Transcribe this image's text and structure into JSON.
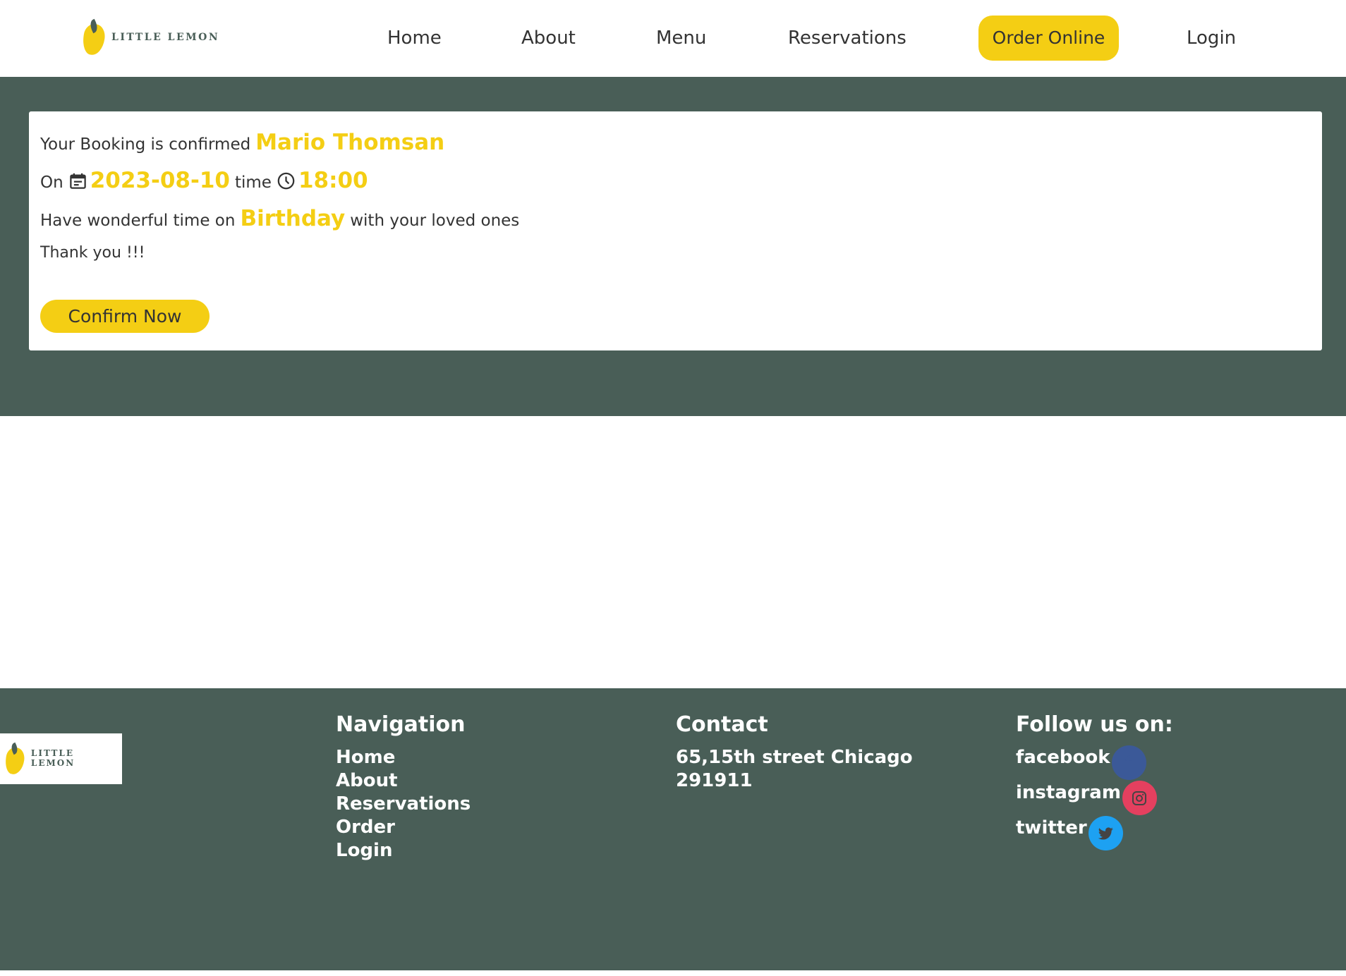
{
  "brand": {
    "name": "LITTLE LEMON"
  },
  "nav": {
    "home": "Home",
    "about": "About",
    "menu": "Menu",
    "reservations": "Reservations",
    "order_online": "Order Online",
    "login": "Login"
  },
  "booking": {
    "confirmed_text": "Your Booking is confirmed",
    "name": "Mario Thomsan",
    "on_text": "On",
    "date": "2023-08-10",
    "time_text": "time",
    "time": "18:00",
    "wish_prefix": "Have wonderful time on",
    "occasion": "Birthday",
    "wish_suffix": "with your loved ones",
    "thanks": "Thank you !!!",
    "confirm_button": "Confirm Now",
    "icons": [
      "calendar-icon",
      "clock-icon"
    ]
  },
  "footer": {
    "navigation": {
      "heading": "Navigation",
      "links": [
        "Home",
        "About",
        "Reservations",
        "Order",
        "Login"
      ]
    },
    "contact": {
      "heading": "Contact",
      "address": "65,15th street Chicago",
      "zip": "291911"
    },
    "follow": {
      "heading": "Follow us on:",
      "items": [
        {
          "label": "facebook",
          "icon": "facebook-icon",
          "color": "#3b5998"
        },
        {
          "label": "instagram",
          "icon": "instagram-icon",
          "color": "#e4405f"
        },
        {
          "label": "twitter",
          "icon": "twitter-icon",
          "color": "#1da1f2"
        }
      ]
    }
  },
  "colors": {
    "primary_green": "#495e57",
    "accent_yellow": "#f4ce14",
    "text_dark": "#333333",
    "white": "#ffffff"
  }
}
